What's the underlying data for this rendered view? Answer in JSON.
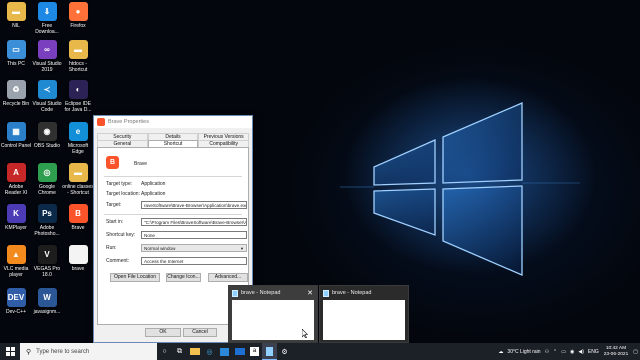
{
  "desktop": {
    "icons": [
      {
        "label": "NIL",
        "icon": "folder-icon",
        "color": "#e8b84a",
        "glyph": "▬",
        "name": "desktop-icon-nil"
      },
      {
        "label": "Free\nDownloa...",
        "icon": "download-icon",
        "color": "#1e88e5",
        "glyph": "⇓",
        "name": "desktop-icon-free-download"
      },
      {
        "label": "Firefox",
        "icon": "firefox-icon",
        "color": "#ff7139",
        "glyph": "●",
        "name": "desktop-icon-firefox"
      },
      {
        "label": "This PC",
        "icon": "computer-icon",
        "color": "#3a8fd8",
        "glyph": "▭",
        "name": "desktop-icon-this-pc"
      },
      {
        "label": "Visual Studio\n2019",
        "icon": "visual-studio-icon",
        "color": "#7a3fbf",
        "glyph": "∞",
        "name": "desktop-icon-visual-studio"
      },
      {
        "label": "htdocs -\nShortcut",
        "icon": "folder-icon",
        "color": "#e8b84a",
        "glyph": "▬",
        "name": "desktop-icon-htdocs"
      },
      {
        "label": "Recycle Bin",
        "icon": "recycle-bin-icon",
        "color": "#9aa3ad",
        "glyph": "♻",
        "name": "desktop-icon-recycle-bin"
      },
      {
        "label": "Visual Studio\nCode",
        "icon": "vscode-icon",
        "color": "#1f8ad2",
        "glyph": "≺",
        "name": "desktop-icon-vscode"
      },
      {
        "label": "Eclipse IDE\nfor Java D...",
        "icon": "eclipse-icon",
        "color": "#2c2255",
        "glyph": "◐",
        "name": "desktop-icon-eclipse"
      },
      {
        "label": "Control Panel",
        "icon": "control-panel-icon",
        "color": "#2a7fc8",
        "glyph": "▦",
        "name": "desktop-icon-control-panel"
      },
      {
        "label": "OBS Studio",
        "icon": "obs-icon",
        "color": "#303030",
        "glyph": "◉",
        "name": "desktop-icon-obs"
      },
      {
        "label": "Microsoft\nEdge",
        "icon": "edge-icon",
        "color": "#138fd8",
        "glyph": "e",
        "name": "desktop-icon-edge"
      },
      {
        "label": "Adobe\nReader XI",
        "icon": "adobe-reader-icon",
        "color": "#c62828",
        "glyph": "A",
        "name": "desktop-icon-adobe-reader"
      },
      {
        "label": "Google\nChrome",
        "icon": "chrome-icon",
        "color": "#2e9e4f",
        "glyph": "◎",
        "name": "desktop-icon-chrome"
      },
      {
        "label": "online classes\n- Shortcut",
        "icon": "folder-icon",
        "color": "#e8b84a",
        "glyph": "▬",
        "name": "desktop-icon-online-classes"
      },
      {
        "label": "KMPlayer",
        "icon": "kmplayer-icon",
        "color": "#4b3bb5",
        "glyph": "K",
        "name": "desktop-icon-kmplayer"
      },
      {
        "label": "Adobe\nPhotosho...",
        "icon": "photoshop-icon",
        "color": "#0b2a4a",
        "glyph": "Ps",
        "name": "desktop-icon-photoshop"
      },
      {
        "label": "Brave",
        "icon": "brave-icon",
        "color": "#fb542b",
        "glyph": "B",
        "name": "desktop-icon-brave"
      },
      {
        "label": "VLC media\nplayer",
        "icon": "vlc-icon",
        "color": "#f28a1e",
        "glyph": "▲",
        "name": "desktop-icon-vlc"
      },
      {
        "label": "VEGAS Pro\n18.0",
        "icon": "vegas-icon",
        "color": "#1d1d1d",
        "glyph": "V",
        "name": "desktop-icon-vegas"
      },
      {
        "label": "brave",
        "icon": "text-file-icon",
        "color": "#f4f4f4",
        "glyph": "",
        "name": "desktop-icon-brave-txt"
      },
      {
        "label": "Dev-C++",
        "icon": "devcpp-icon",
        "color": "#2f5da8",
        "glyph": "DEV",
        "name": "desktop-icon-devcpp"
      },
      {
        "label": "javasignm...",
        "icon": "word-icon",
        "color": "#2b5797",
        "glyph": "W",
        "name": "desktop-icon-word-doc"
      }
    ]
  },
  "dialog": {
    "title": "Brave Properties",
    "tabs_row1": [
      "Security",
      "Details",
      "Previous Versions"
    ],
    "tabs_row2": [
      "General",
      "Shortcut",
      "Compatibility"
    ],
    "app_name": "Brave",
    "target_type_label": "Target type:",
    "target_type_value": "Application",
    "target_location_label": "Target location:",
    "target_location_value": "Application",
    "target_label": "Target:",
    "target_value": "raveSoftware\\Brave-Browser\\Application\\brave.exe\"",
    "start_in_label": "Start in:",
    "start_in_value": "\"C:\\Program Files\\BraveSoftware\\Brave-Browser\\Ap",
    "shortcut_key_label": "Shortcut key:",
    "shortcut_key_value": "None",
    "run_label": "Run:",
    "run_value": "Normal window",
    "comment_label": "Comment:",
    "comment_value": "Access the Internet",
    "open_location_label": "Open File Location",
    "change_icon_label": "Change Icon...",
    "advanced_label": "Advanced...",
    "ok_label": "OK",
    "cancel_label": "Cancel"
  },
  "thumbnails": [
    {
      "title": "brave - Notepad",
      "close": "✕"
    },
    {
      "title": "brave - Notepad"
    }
  ],
  "taskbar": {
    "search_placeholder": "Type here to search",
    "weather": "30°C  Light rain",
    "language": "ENG",
    "time": "10:42 AM",
    "date": "23-06-2021",
    "accent": "#7fb8ff"
  }
}
